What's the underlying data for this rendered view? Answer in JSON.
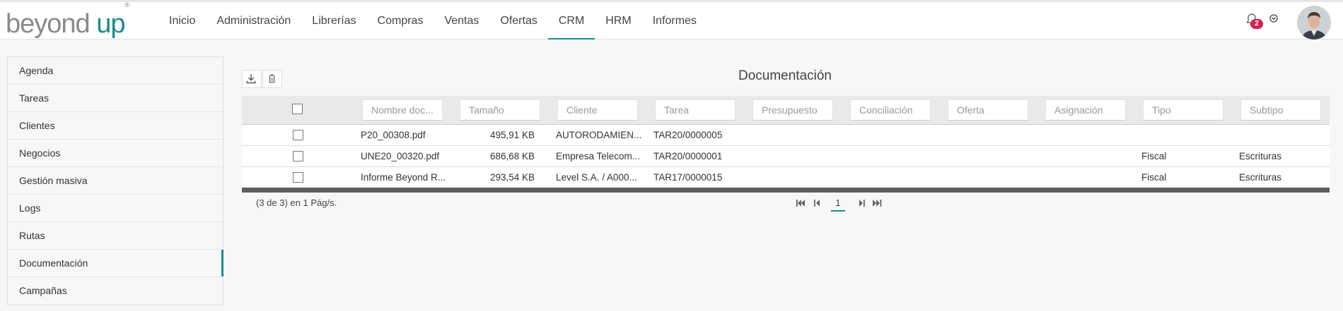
{
  "app": {
    "logo_left": "beyond",
    "logo_right": "up",
    "logo_reg": "®"
  },
  "nav": {
    "items": [
      {
        "label": "Inicio"
      },
      {
        "label": "Administración"
      },
      {
        "label": "Librerías"
      },
      {
        "label": "Compras"
      },
      {
        "label": "Ventas"
      },
      {
        "label": "Ofertas"
      },
      {
        "label": "CRM",
        "active": true
      },
      {
        "label": "HRM"
      },
      {
        "label": "Informes"
      }
    ]
  },
  "header_actions": {
    "notifications_count": "2",
    "bell_icon": "bell-icon",
    "menu_icon": "chevron-down-circle-icon"
  },
  "sidebar": {
    "items": [
      {
        "label": "Agenda"
      },
      {
        "label": "Tareas"
      },
      {
        "label": "Clientes"
      },
      {
        "label": "Negocios"
      },
      {
        "label": "Gestión masiva"
      },
      {
        "label": "Logs"
      },
      {
        "label": "Rutas"
      },
      {
        "label": "Documentación",
        "active": true
      },
      {
        "label": "Campañas"
      }
    ]
  },
  "main": {
    "title": "Documentación",
    "toolbar": {
      "download_icon": "download-icon",
      "delete_icon": "trash-icon"
    },
    "filters": [
      {
        "placeholder": "Nombre doc..."
      },
      {
        "placeholder": "Tamaño"
      },
      {
        "placeholder": "Cliente"
      },
      {
        "placeholder": "Tarea"
      },
      {
        "placeholder": "Presupuesto"
      },
      {
        "placeholder": "Conciliación"
      },
      {
        "placeholder": "Oferta"
      },
      {
        "placeholder": "Asignación"
      },
      {
        "placeholder": "Tipo"
      },
      {
        "placeholder": "Subtipo"
      }
    ],
    "rows": [
      {
        "nombre": "P20_00308.pdf",
        "tamano": "495,91 KB",
        "cliente": "AUTORODAMIEN...",
        "tarea": "TAR20/0000005",
        "tipo": "",
        "subtipo": ""
      },
      {
        "nombre": "UNE20_00320.pdf",
        "tamano": "686,68 KB",
        "cliente": "Empresa Telecom...",
        "tarea": "TAR20/0000001",
        "tipo": "Fiscal",
        "subtipo": "Escrituras"
      },
      {
        "nombre": "Informe Beyond R...",
        "tamano": "293,54 KB",
        "cliente": "Level S.A. / A000...",
        "tarea": "TAR17/0000015",
        "tipo": "Fiscal",
        "subtipo": "Escrituras"
      }
    ],
    "pagination": {
      "info": "(3 de 3) en 1 Pág/s.",
      "current_page": "1"
    }
  },
  "colors": {
    "accent": "#1a8c8f",
    "badge": "#d6234f",
    "grid_footer": "#5d5d5d"
  }
}
